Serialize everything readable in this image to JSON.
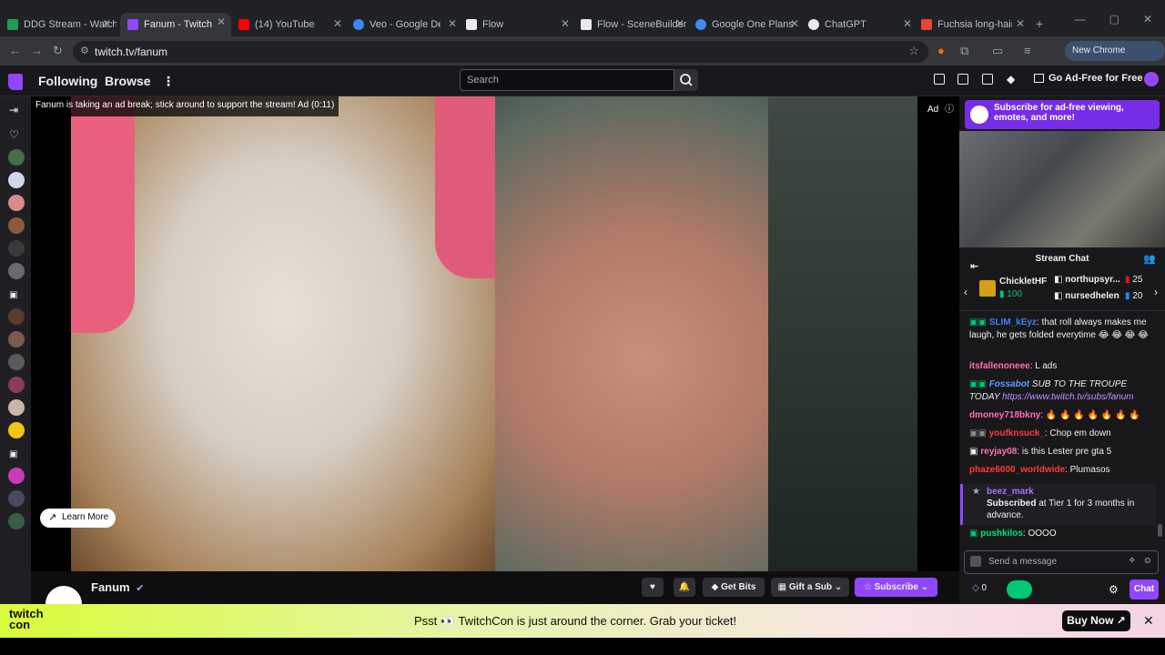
{
  "browser": {
    "tabs": [
      {
        "label": "DDG Stream - Watch",
        "color": "#1f9d55"
      },
      {
        "label": "Fanum - Twitch",
        "color": "#9147ff",
        "active": true
      },
      {
        "label": "(14) YouTube",
        "color": "#ff0000"
      },
      {
        "label": "Veo - Google DeepM",
        "color": "#4285f4"
      },
      {
        "label": "Flow",
        "color": "#e8eaed"
      },
      {
        "label": "Flow - SceneBuilder",
        "color": "#e8eaed"
      },
      {
        "label": "Google One Plans",
        "color": "#4285f4"
      },
      {
        "label": "ChatGPT",
        "color": "#e8eaed"
      },
      {
        "label": "Fuchsia long-hair cat",
        "color": "#ea4335"
      }
    ],
    "new_tab": "+",
    "url": "twitch.tv/fanum",
    "new_chrome_label": "New Chrome available"
  },
  "nav": {
    "following": "Following",
    "browse": "Browse",
    "more": "⋮",
    "search_placeholder": "Search",
    "ad_free": "Go Ad-Free for Free"
  },
  "player": {
    "ad_banner": "Fanum is taking an ad break; stick around to support the stream! Ad (0:11)",
    "ad_label": "Ad",
    "learn_more": "Learn More"
  },
  "channel": {
    "name": "Fanum",
    "buttons": {
      "get_bits": "Get Bits",
      "gift_sub": "Gift a Sub",
      "subscribe": "Subscribe"
    }
  },
  "chat": {
    "promo": "Subscribe for ad-free viewing, emotes, and more!",
    "header": "Stream Chat",
    "leaderboard": [
      {
        "name": "ChickletHF",
        "score": "100"
      },
      {
        "name": "northupsyr...",
        "score": "25"
      },
      {
        "name": "nursedhelen",
        "score": "20"
      }
    ],
    "messages": [
      {
        "user": "SLIM_kEyz",
        "user_color": "#3b82f6",
        "text": ": that roll always makes me laugh, he gets folded everytime 😂 😂 😂 😂"
      },
      {
        "user": "itsfallenoneee",
        "user_color": "#ff6fb5",
        "text": ": L ads"
      },
      {
        "user": "Fossabot",
        "user_color": "#5b9dff",
        "text": " SUB TO THE TROUPE TODAY ",
        "link": "https://www.twitch.tv/subs/fanum"
      },
      {
        "user": "dmoney718bkny",
        "user_color": "#ff6fb5",
        "text": ": 🔥 🔥 🔥 🔥 🔥 🔥 🔥"
      },
      {
        "user": "youfknsuck_",
        "user_color": "#ff3b3b",
        "text": ": Chop em down"
      },
      {
        "user": "reyjay08",
        "user_color": "#ff6fb5",
        "text": ": is this Lester pre gta 5"
      },
      {
        "user": "phaze6000_worldwide",
        "user_color": "#ff3b3b",
        "text": ": Plumasos"
      }
    ],
    "sub_notice": {
      "user": "beez_mark",
      "bold": "Subscribed",
      "text": " at Tier 1 for 3 months in advance."
    },
    "last_message": {
      "user": "pushkilos",
      "user_color": "#00e676",
      "text": ": OOOO"
    },
    "input_placeholder": "Send a message",
    "points": "0",
    "chat_button": "Chat"
  },
  "promo_banner": {
    "logo_line1": "twitch",
    "logo_line2": "con",
    "text": "Psst 👀 TwitchCon is just around the corner. Grab your ticket!",
    "buy_now": "Buy Now ↗",
    "close": "✕"
  },
  "icons": [
    "twitch-logo-icon",
    "search-icon",
    "crown-icon",
    "inbox-icon",
    "whispers-icon",
    "bits-icon",
    "profile-icon",
    "heart-icon",
    "bell-icon",
    "settings-icon",
    "emote-icon"
  ],
  "colors": {
    "brand": "#9147ff",
    "bg": "#0e0e10",
    "panel": "#18181b",
    "banner_start": "#d8fb3a"
  }
}
